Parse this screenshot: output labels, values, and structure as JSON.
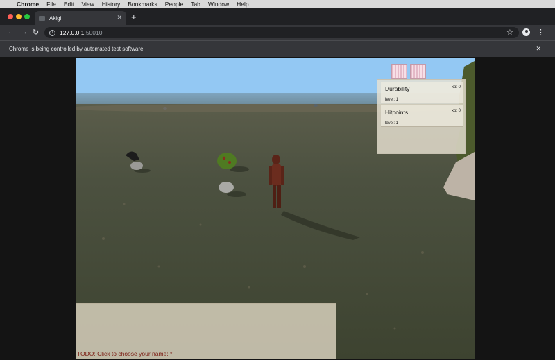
{
  "menubar": {
    "app": "Chrome",
    "items": [
      "File",
      "Edit",
      "View",
      "History",
      "Bookmarks",
      "People",
      "Tab",
      "Window",
      "Help"
    ]
  },
  "browser": {
    "tab_title": "Akigi",
    "url_host": "127.0.0.1",
    "url_port": ":50010",
    "infobar_text": "Chrome is being controlled by automated test software.",
    "icons": [
      "back-arrow-icon",
      "forward-arrow-icon",
      "reload-icon",
      "info-icon",
      "star-icon",
      "profile-icon",
      "kebab-menu-icon",
      "close-icon",
      "plus-icon"
    ]
  },
  "game": {
    "skills": [
      {
        "name": "Durability",
        "xp": "xp: 0",
        "level": "level: 1"
      },
      {
        "name": "Hitpoints",
        "xp": "xp: 0",
        "level": "level: 1"
      }
    ],
    "inventory_slots": 2,
    "chat_prompt": "TODO: Click to choose your name: *"
  },
  "colors": {
    "sky": "#8fc6f1",
    "ground": "#4f5342",
    "panel": "#e8e2d2",
    "chat_text": "#7b1c12"
  }
}
